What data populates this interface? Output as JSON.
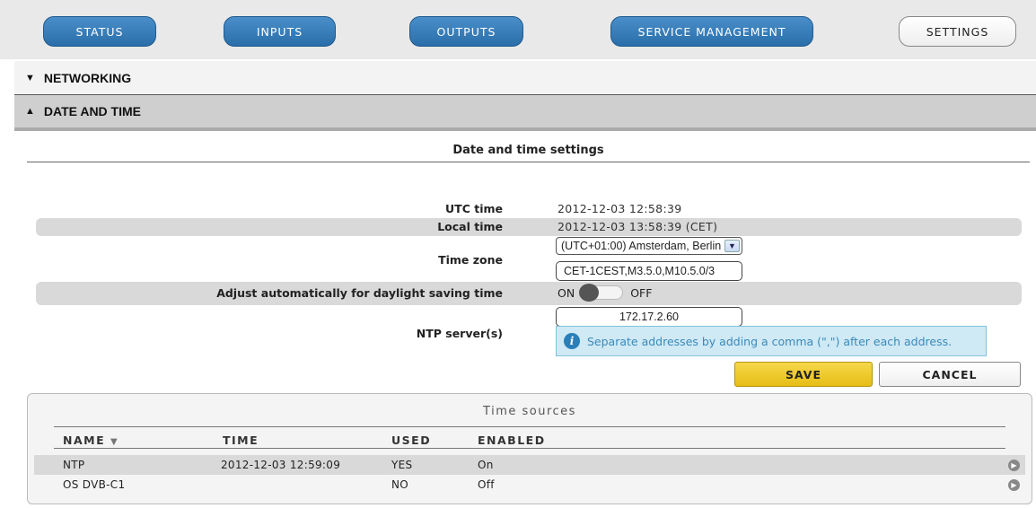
{
  "nav": {
    "tabs": [
      {
        "label": "STATUS"
      },
      {
        "label": "INPUTS"
      },
      {
        "label": "OUTPUTS"
      },
      {
        "label": "SERVICE MANAGEMENT"
      },
      {
        "label": "SETTINGS"
      }
    ],
    "active": "SETTINGS"
  },
  "sections": {
    "networking": {
      "label": "NETWORKING",
      "icon": "triangle-down-icon"
    },
    "date_time": {
      "label": "DATE AND TIME",
      "icon": "triangle-up-icon"
    }
  },
  "datetime": {
    "title": "Date and time settings",
    "utc_label": "UTC time",
    "utc_value": "2012-12-03 12:58:39",
    "local_label": "Local time",
    "local_value": "2012-12-03 13:58:39 (CET)",
    "tz_label": "Time zone",
    "tz_select_value": "(UTC+01:00) Amsterdam, Berlin",
    "tz_string": "CET-1CEST,M3.5.0,M10.5.0/3",
    "dst_label": "Adjust automatically for daylight saving time",
    "dst_on": "ON",
    "dst_off": "OFF",
    "ntp_label": "NTP server(s)",
    "ntp_value": "172.17.2.60",
    "ntp_info": "Separate addresses by adding a comma (\",\") after each address.",
    "save_label": "SAVE",
    "cancel_label": "CANCEL"
  },
  "time_sources": {
    "title": "Time sources",
    "columns": [
      "NAME",
      "TIME",
      "USED",
      "ENABLED"
    ],
    "rows": [
      {
        "name": "NTP",
        "time": "2012-12-03 12:59:09",
        "used": "YES",
        "enabled": "On"
      },
      {
        "name": "OS DVB-C1",
        "time": "",
        "used": "NO",
        "enabled": "Off"
      }
    ]
  }
}
